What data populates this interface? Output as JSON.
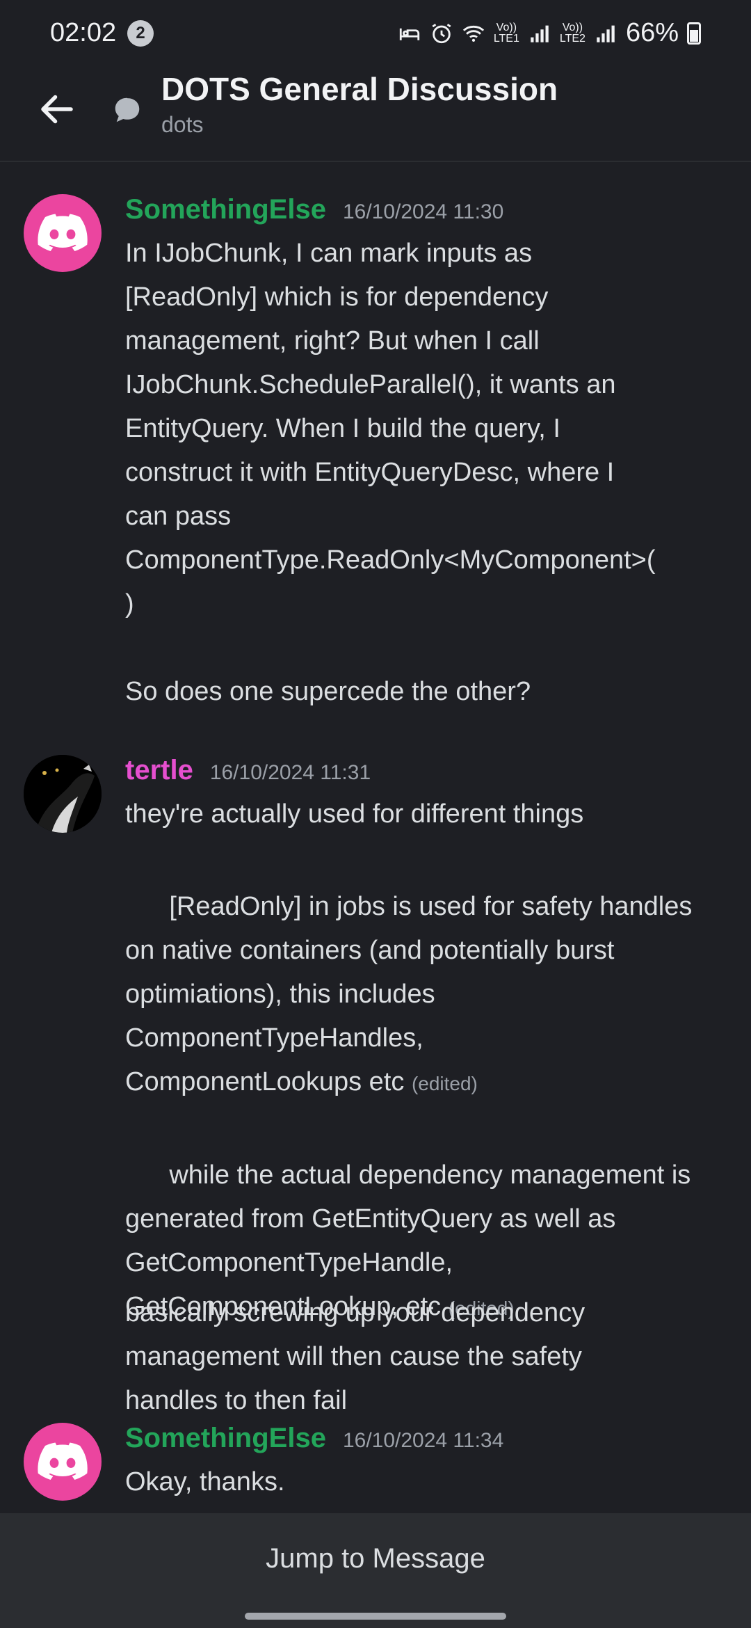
{
  "status_bar": {
    "time": "02:02",
    "notification_count": "2",
    "sim1_label": "Vo))\nLTE1",
    "sim2_label": "Vo))\nLTE2",
    "wifi_label": "6",
    "battery": "66%"
  },
  "header": {
    "title": "DOTS General Discussion",
    "subtitle": "dots"
  },
  "messages": [
    {
      "author": "SomethingElse",
      "author_color": "#23a55a",
      "timestamp": "16/10/2024 11:30",
      "avatar": "discord-logo-icon",
      "paragraphs": [
        "In IJobChunk, I can mark inputs as\n[ReadOnly] which is for dependency\nmanagement, right? But when I call\nIJobChunk.ScheduleParallel(), it wants an\nEntityQuery. When I build the query, I\nconstruct it with EntityQueryDesc, where I\ncan pass\nComponentType.ReadOnly<MyComponent>(\n)\n\nSo does one supercede the other?"
      ]
    },
    {
      "author": "tertle",
      "author_color": "#e64fcf",
      "timestamp": "16/10/2024 11:31",
      "avatar": "user-avatar-image",
      "paragraphs": [
        "they're actually used for different things",
        "[ReadOnly] in jobs is used for safety handles\non native containers (and potentially burst\noptimiations), this includes\nComponentTypeHandles,\nComponentLookups etc",
        "while the actual dependency management is\ngenerated from GetEntityQuery as well as\nGetComponentTypeHandle,\nGetComponentLookup, etc",
        "basically screwing up your dependency\nmanagement will then cause the safety\nhandles to then fail"
      ],
      "edited_label": "(edited)"
    },
    {
      "author": "SomethingElse",
      "author_color": "#23a55a",
      "timestamp": "16/10/2024 11:34",
      "avatar": "discord-logo-icon",
      "paragraphs": [
        "Okay, thanks."
      ]
    }
  ],
  "jump_button": "Jump to Message"
}
